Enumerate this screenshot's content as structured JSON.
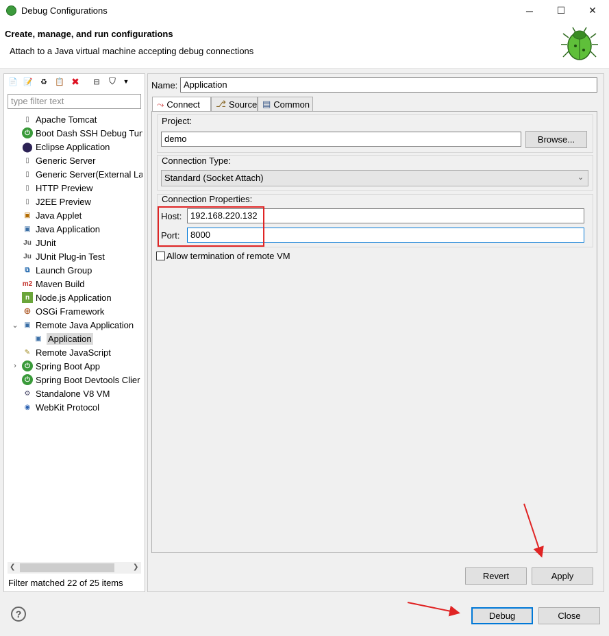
{
  "window": {
    "title": "Debug Configurations",
    "minimize": "─",
    "maximize": "☐",
    "close": "✕"
  },
  "header": {
    "title": "Create, manage, and run configurations",
    "subtitle": "Attach to a Java virtual machine accepting debug connections"
  },
  "left": {
    "filter_placeholder": "type filter text",
    "items": [
      {
        "label": "Apache Tomcat",
        "icon": "tomcat-icon"
      },
      {
        "label": "Boot Dash SSH Debug Tun",
        "icon": "boot-dash-icon"
      },
      {
        "label": "Eclipse Application",
        "icon": "eclipse-icon"
      },
      {
        "label": "Generic Server",
        "icon": "server-icon"
      },
      {
        "label": "Generic Server(External Lau",
        "icon": "server-icon"
      },
      {
        "label": "HTTP Preview",
        "icon": "server-icon"
      },
      {
        "label": "J2EE Preview",
        "icon": "server-icon"
      },
      {
        "label": "Java Applet",
        "icon": "applet-icon"
      },
      {
        "label": "Java Application",
        "icon": "java-app-icon"
      },
      {
        "label": "JUnit",
        "icon": "junit-icon"
      },
      {
        "label": "JUnit Plug-in Test",
        "icon": "junit-plugin-icon"
      },
      {
        "label": "Launch Group",
        "icon": "launch-group-icon"
      },
      {
        "label": "Maven Build",
        "icon": "maven-icon"
      },
      {
        "label": "Node.js Application",
        "icon": "nodejs-icon"
      },
      {
        "label": "OSGi Framework",
        "icon": "osgi-icon"
      },
      {
        "label": "Remote Java Application",
        "icon": "remote-java-icon"
      },
      {
        "label": "Application",
        "icon": "remote-java-icon"
      },
      {
        "label": "Remote JavaScript",
        "icon": "remote-js-icon"
      },
      {
        "label": "Spring Boot App",
        "icon": "spring-boot-icon"
      },
      {
        "label": "Spring Boot Devtools Clier",
        "icon": "spring-devtools-icon"
      },
      {
        "label": "Standalone V8 VM",
        "icon": "v8-icon"
      },
      {
        "label": "WebKit Protocol",
        "icon": "webkit-icon"
      }
    ],
    "status": "Filter matched 22 of 25 items"
  },
  "right": {
    "name_label": "Name:",
    "name_value": "Application",
    "tabs": [
      {
        "label": "Connect"
      },
      {
        "label": "Source"
      },
      {
        "label": "Common"
      }
    ],
    "project_label": "Project:",
    "project_value": "demo",
    "browse_label": "Browse...",
    "connection_type_label": "Connection Type:",
    "connection_type_value": "Standard (Socket Attach)",
    "connection_props_label": "Connection Properties:",
    "host_label": "Host:",
    "host_value": "192.168.220.132",
    "port_label": "Port:",
    "port_value": "8000",
    "allow_termination_label": "Allow termination of remote VM",
    "revert_label": "Revert",
    "apply_label": "Apply"
  },
  "footer": {
    "help": "?",
    "debug_label": "Debug",
    "close_label": "Close"
  }
}
